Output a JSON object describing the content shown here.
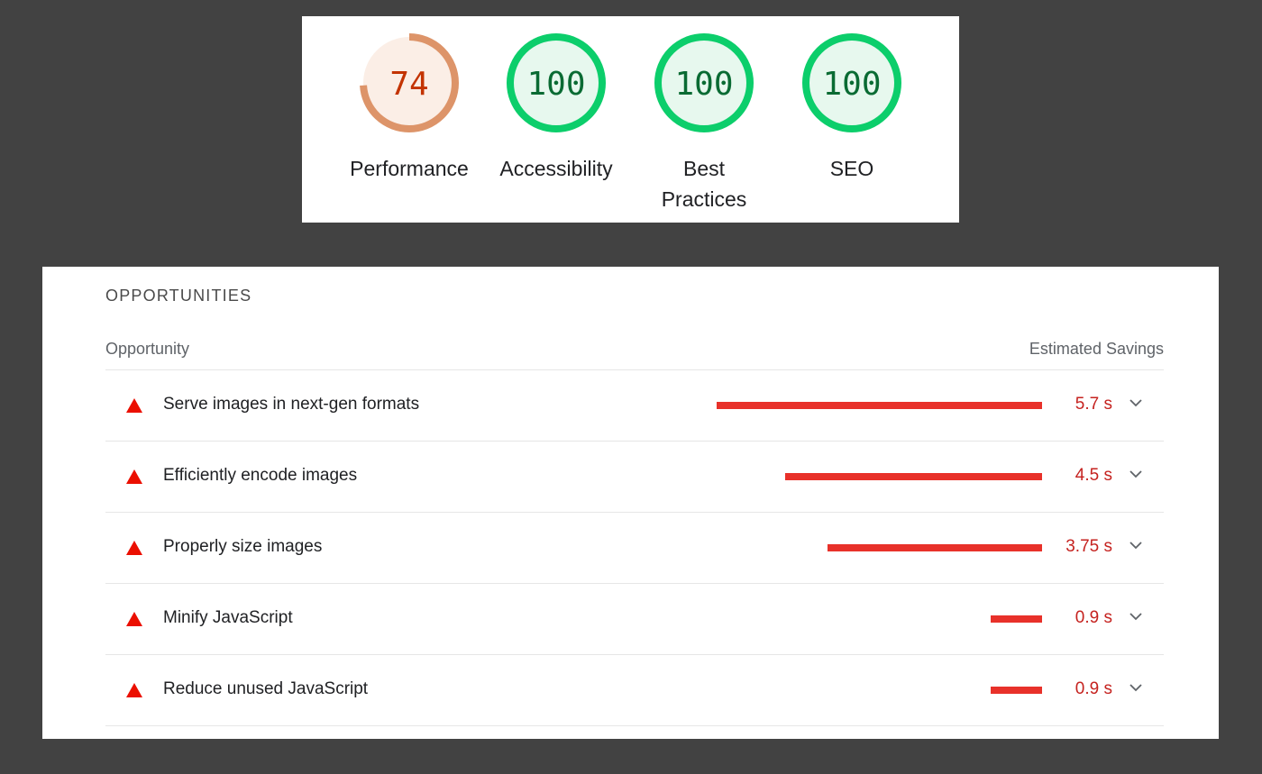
{
  "colors": {
    "background": "#424242",
    "score_average": "#c33300",
    "score_average_ring": "#dd9469",
    "score_pass": "#0a6b33",
    "score_pass_ring": "#0cce6b",
    "fail": "#eb0f00",
    "bar": "#e8312a"
  },
  "scores": [
    {
      "label": "Performance",
      "value": "74",
      "fraction": 0.74,
      "status": "average"
    },
    {
      "label": "Accessibility",
      "value": "100",
      "fraction": 1.0,
      "status": "pass"
    },
    {
      "label": "Best\nPractices",
      "value": "100",
      "fraction": 1.0,
      "status": "pass"
    },
    {
      "label": "SEO",
      "value": "100",
      "fraction": 1.0,
      "status": "pass"
    }
  ],
  "opportunities": {
    "title": "OPPORTUNITIES",
    "col_opportunity": "Opportunity",
    "col_savings": "Estimated Savings",
    "items": [
      {
        "title": "Serve images in next-gen formats",
        "savings": "5.7 s",
        "savings_seconds": 5.7,
        "icon": "warning-triangle-icon"
      },
      {
        "title": "Efficiently encode images",
        "savings": "4.5 s",
        "savings_seconds": 4.5,
        "icon": "warning-triangle-icon"
      },
      {
        "title": "Properly size images",
        "savings": "3.75 s",
        "savings_seconds": 3.75,
        "icon": "warning-triangle-icon"
      },
      {
        "title": "Minify JavaScript",
        "savings": "0.9 s",
        "savings_seconds": 0.9,
        "icon": "warning-triangle-icon"
      },
      {
        "title": "Reduce unused JavaScript",
        "savings": "0.9 s",
        "savings_seconds": 0.9,
        "icon": "warning-triangle-icon"
      }
    ]
  }
}
